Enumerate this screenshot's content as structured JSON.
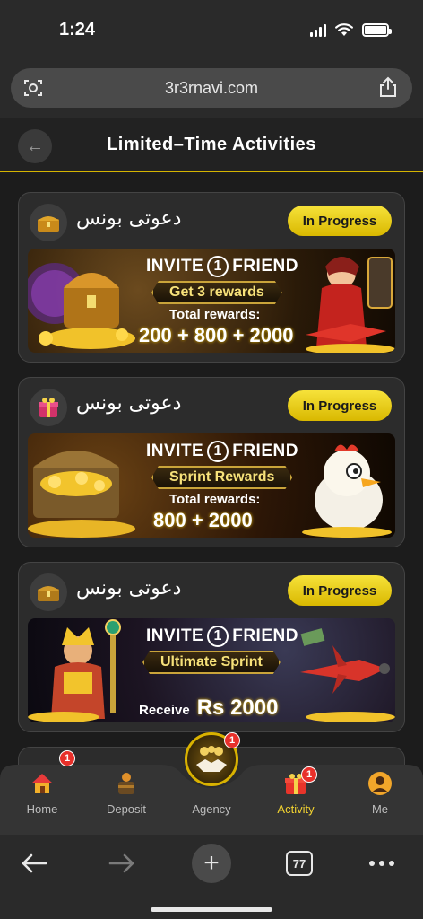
{
  "status_bar": {
    "time": "1:24"
  },
  "browser": {
    "url": "3r3rnavi.com",
    "tab_count": "77"
  },
  "header": {
    "back_icon": "arrow-left-icon",
    "title": "Limited–Time Activities"
  },
  "cards": [
    {
      "title": "دعوتی بونس",
      "status": "In Progress",
      "banner": {
        "invite_prefix": "INVITE",
        "invite_number": "1",
        "invite_suffix": "FRIEND",
        "ribbon": "Get 3 rewards",
        "total_label": "Total rewards:",
        "amounts": "200 + 800 + 2000"
      }
    },
    {
      "title": "دعوتی بونس",
      "status": "In Progress",
      "banner": {
        "invite_prefix": "INVITE",
        "invite_number": "1",
        "invite_suffix": "FRIEND",
        "ribbon": "Sprint Rewards",
        "total_label": "Total rewards:",
        "amounts": "800 + 2000"
      }
    },
    {
      "title": "دعوتی بونس",
      "status": "In Progress",
      "banner": {
        "invite_prefix": "INVITE",
        "invite_number": "1",
        "invite_suffix": "FRIEND",
        "ribbon": "Ultimate Sprint",
        "receive_label": "Receive",
        "receive_amount": "Rs 2000"
      }
    }
  ],
  "bottom_nav": {
    "home": {
      "label": "Home",
      "icon": "house-icon",
      "badge": "1"
    },
    "deposit": {
      "label": "Deposit",
      "icon": "piggy-bank-icon"
    },
    "agency": {
      "label": "Agency",
      "icon": "handshake-icon",
      "badge": "1"
    },
    "activity": {
      "label": "Activity",
      "icon": "gift-icon",
      "badge": "1"
    },
    "me": {
      "label": "Me",
      "icon": "user-avatar-icon"
    }
  },
  "colors": {
    "accent": "#f1d230",
    "badge": "#e8302a",
    "background": "#1c1c1c"
  }
}
